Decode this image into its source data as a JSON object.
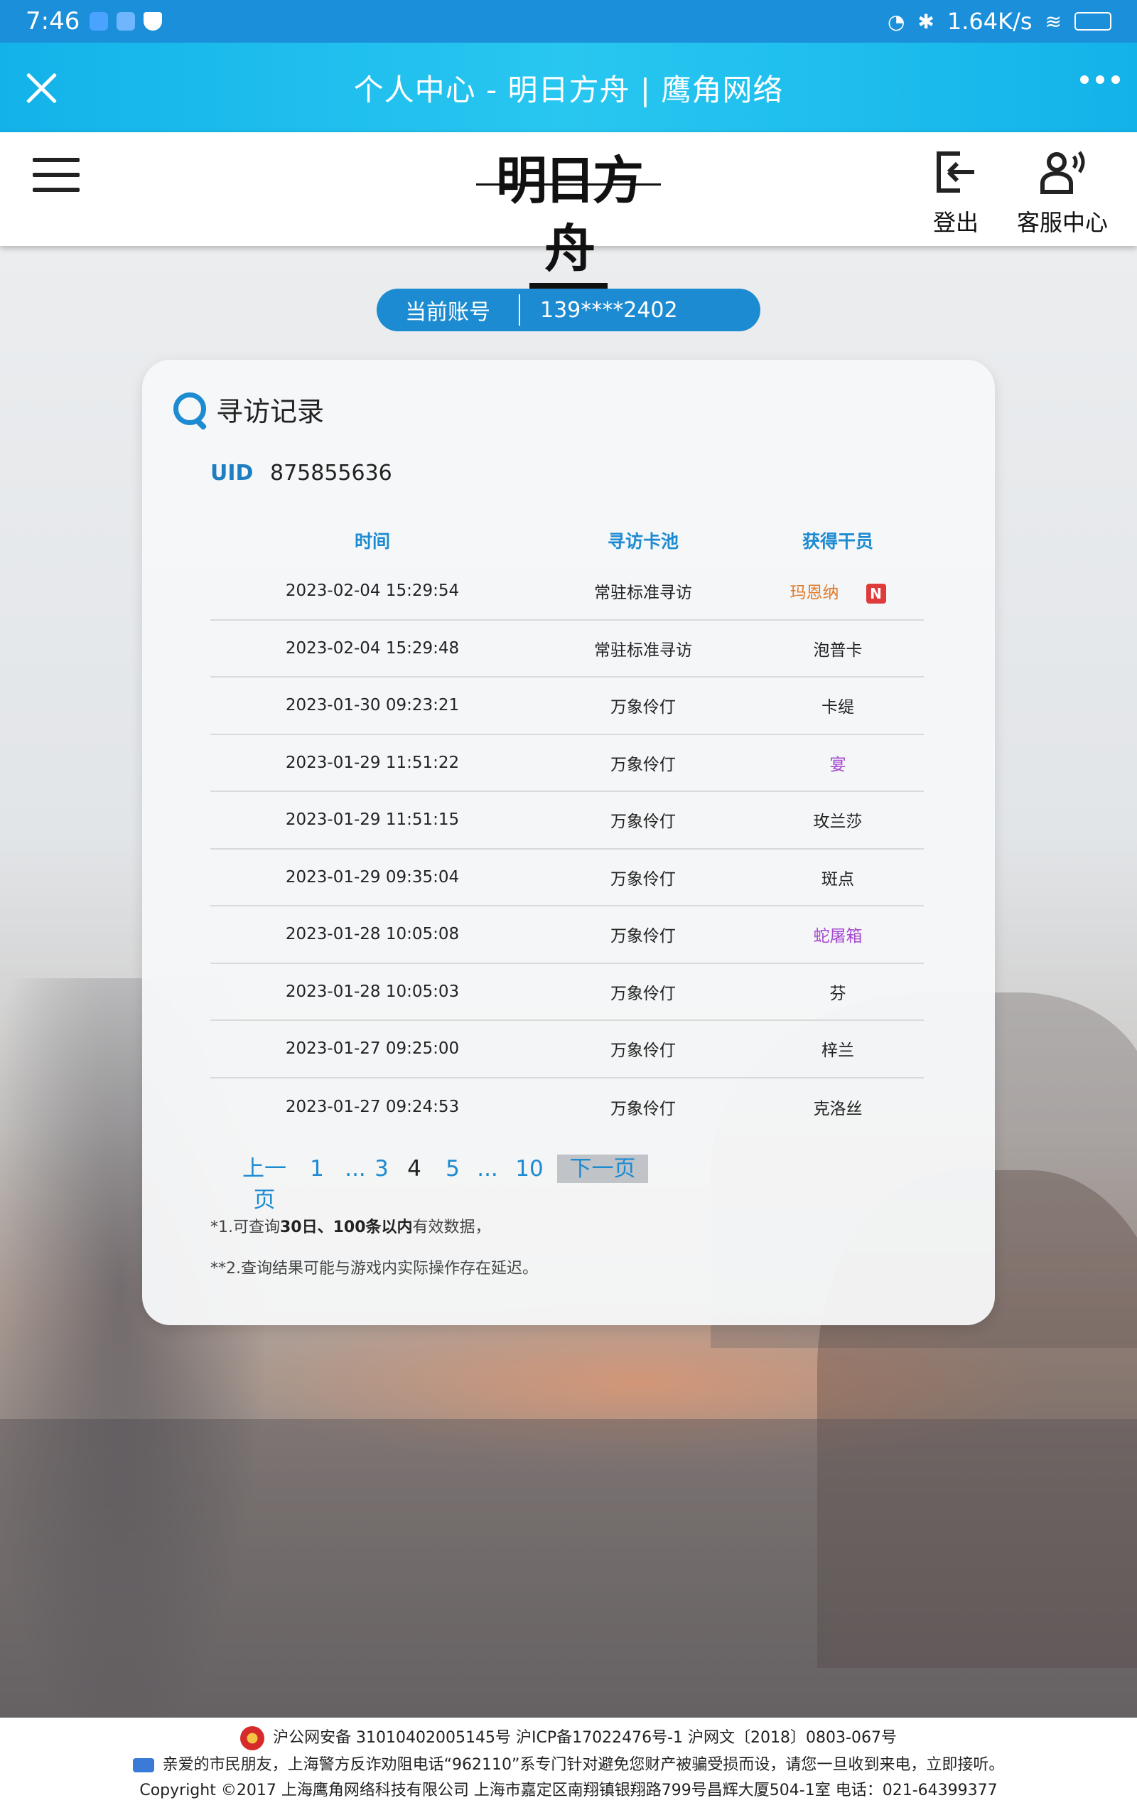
{
  "status_bar": {
    "time": "7:46",
    "net_speed": "1.64K/s",
    "battery": "97",
    "battery_level": 0.97
  },
  "titlebar": {
    "title": "个人中心 - 明日方舟 | 鹰角网络"
  },
  "header": {
    "logo_text": "明日方舟",
    "logout_label": "登出",
    "service_label": "客服中心"
  },
  "account": {
    "label": "当前账号",
    "value": "139****2402"
  },
  "card": {
    "title": "寻访记录",
    "uid_label": "UID",
    "uid_value": "875855636",
    "columns": [
      "时间",
      "寻访卡池",
      "获得干员"
    ],
    "rows": [
      {
        "time": "2023-02-04 15:29:54",
        "pool": "常驻标准寻访",
        "operator": "玛恩纳",
        "rarity": "orange",
        "is_new": true,
        "new_label": "N"
      },
      {
        "time": "2023-02-04 15:29:48",
        "pool": "常驻标准寻访",
        "operator": "泡普卡",
        "rarity": "normal",
        "is_new": false
      },
      {
        "time": "2023-01-30 09:23:21",
        "pool": "万象伶仃",
        "operator": "卡缇",
        "rarity": "normal",
        "is_new": false
      },
      {
        "time": "2023-01-29 11:51:22",
        "pool": "万象伶仃",
        "operator": "宴",
        "rarity": "purple",
        "is_new": false
      },
      {
        "time": "2023-01-29 11:51:15",
        "pool": "万象伶仃",
        "operator": "玫兰莎",
        "rarity": "normal",
        "is_new": false
      },
      {
        "time": "2023-01-29 09:35:04",
        "pool": "万象伶仃",
        "operator": "斑点",
        "rarity": "normal",
        "is_new": false
      },
      {
        "time": "2023-01-28 10:05:08",
        "pool": "万象伶仃",
        "operator": "蛇屠箱",
        "rarity": "purple",
        "is_new": false
      },
      {
        "time": "2023-01-28 10:05:03",
        "pool": "万象伶仃",
        "operator": "芬",
        "rarity": "normal",
        "is_new": false
      },
      {
        "time": "2023-01-27 09:25:00",
        "pool": "万象伶仃",
        "operator": "梓兰",
        "rarity": "normal",
        "is_new": false
      },
      {
        "time": "2023-01-27 09:24:53",
        "pool": "万象伶仃",
        "operator": "克洛丝",
        "rarity": "normal",
        "is_new": false
      }
    ],
    "pager": {
      "prev": "上一页",
      "items": [
        "1",
        "...",
        "3",
        "4",
        "5",
        "...",
        "10"
      ],
      "current": "4",
      "next": "下一页"
    },
    "note1_prefix": "*1.可查询",
    "note1_bold": "30日、100条以内",
    "note1_suffix": "有效数据，",
    "note2": "**2.查询结果可能与游戏内实际操作存在延迟。"
  },
  "footer": {
    "line1": "沪公网安备 31010402005145号  沪ICP备17022476号-1  沪网文〔2018〕0803-067号",
    "line2": "亲爱的市民朋友，上海警方反诈劝阻电话“962110”系专门针对避免您财产被骗受损而设，请您一旦收到来电，立即接听。",
    "line3": "Copyright ©2017 上海鹰角网络科技有限公司  上海市嘉定区南翔镇银翔路799号昌辉大厦504-1室  电话：021-64399377"
  },
  "colors": {
    "accent": "#1d8bd1",
    "titlebar": "#13b3ea",
    "orange_operator": "#e07b2a",
    "purple_operator": "#a54ad1"
  }
}
